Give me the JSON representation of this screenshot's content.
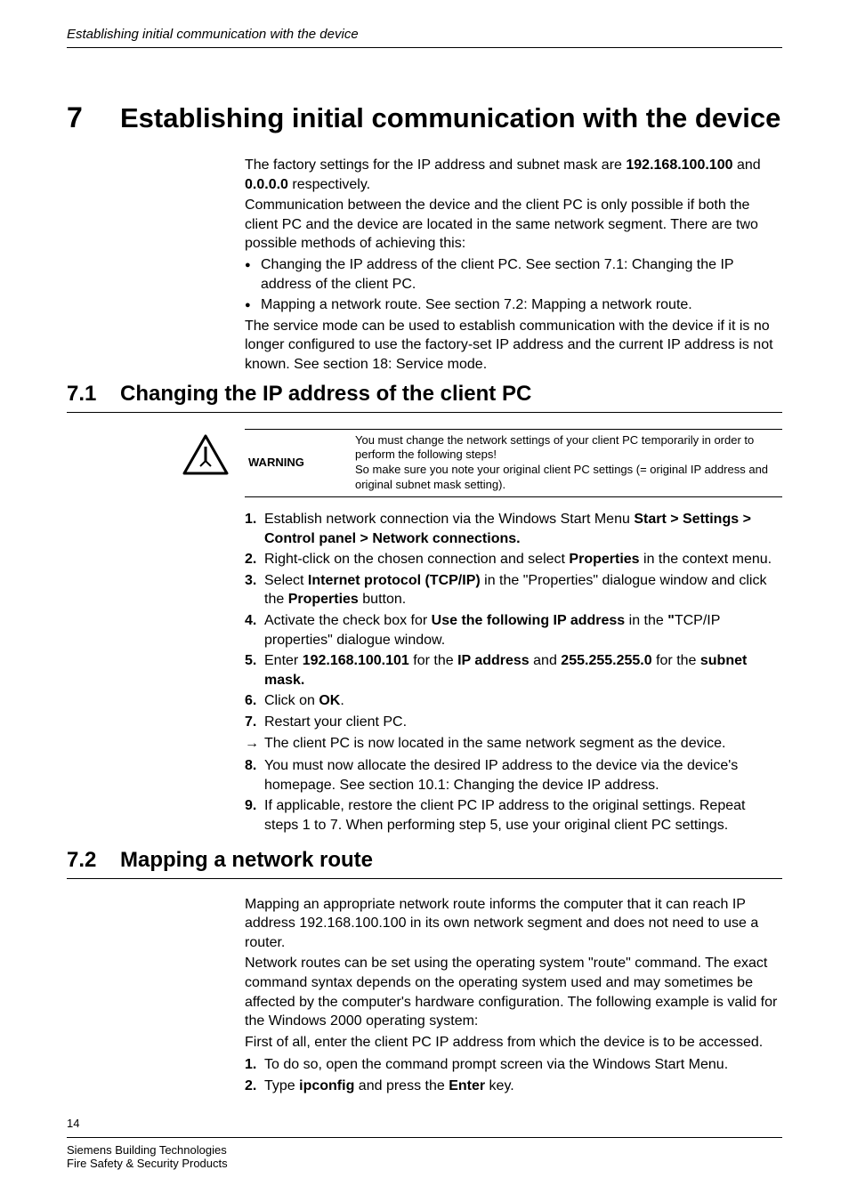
{
  "running_header": "Establishing initial communication with the device",
  "chapter": {
    "num": "7",
    "title": "Establishing initial communication with the device"
  },
  "intro": {
    "p1a": "The factory settings for the IP address and subnet mask are ",
    "p1_ip": "192.168.100.100",
    "p1b": " and ",
    "p1_mask": "0.0.0.0",
    "p1c": " respectively.",
    "p2": "Communication between the device and the client PC is only possible if both the client PC and the device are located in the same network segment. There are two possible methods of achieving this:",
    "bullet1": "Changing the IP address of the client PC. See section 7.1: Changing the IP address of the client PC.",
    "bullet2": "Mapping a network route. See section 7.2: Mapping a network route.",
    "p3": "The service mode can be used to establish communication with the device if it is no longer configured to use the factory-set IP address and the current IP address is not known. See section 18: Service mode."
  },
  "s71": {
    "num": "7.1",
    "title": "Changing the IP address of the client PC",
    "warning_label": "WARNING",
    "warning_text1": "You must change the network settings of your client PC temporarily in order to perform the following steps!",
    "warning_text2": "So make sure you note your original client PC settings (= original IP address and original subnet mask setting).",
    "step1a": "Establish network connection via the Windows Start Menu ",
    "step1b": "Start > Settings > Control panel > Network connections.",
    "step2a": "Right-click on the chosen connection and select ",
    "step2b": "Properties",
    "step2c": " in the context menu.",
    "step3a": "Select ",
    "step3b": "Internet protocol (TCP/IP)",
    "step3c": " in the \"Properties\" dialogue window and click the ",
    "step3d": "Properties",
    "step3e": " button.",
    "step4a": "Activate the check box for ",
    "step4b": "Use the following IP address",
    "step4c": " in the ",
    "step4d": "\"",
    "step4e": "TCP/IP properties\" dialogue window.",
    "step5a": "Enter ",
    "step5b": "192.168.100.101",
    "step5c": " for the ",
    "step5d": "IP address",
    "step5e": " and ",
    "step5f": "255.255.255.0",
    "step5g": " for the ",
    "step5h": "subnet mask.",
    "step6a": "Click on ",
    "step6b": "OK",
    "step6c": ".",
    "step7": "Restart your client PC.",
    "result": "The client PC is now located in the same network segment as the device.",
    "step8": "You must now allocate the desired IP address to the device via the device's homepage. See section 10.1: Changing the device IP address.",
    "step9": "If applicable, restore the client PC IP address to the original settings. Repeat steps 1 to 7. When performing step 5, use your original client PC settings."
  },
  "s72": {
    "num": "7.2",
    "title": "Mapping a network route",
    "p1": "Mapping an appropriate network route informs the computer that it can reach IP address 192.168.100.100 in its own network segment and does not need to use a router.",
    "p2": "Network routes can be set using the operating system \"route\" command. The exact command syntax depends on the operating system used and may sometimes be affected by the computer's hardware configuration. The following example is valid for the Windows 2000 operating system:",
    "p3": "First of all, enter the client PC IP address from which the device is to be accessed.",
    "step1": "To do so, open the command prompt screen via the Windows Start Menu.",
    "step2a": "Type ",
    "step2b": "ipconfig",
    "step2c": " and press the ",
    "step2d": "Enter",
    "step2e": " key."
  },
  "footer": {
    "page": "14",
    "line1": "Siemens Building Technologies",
    "line2": "Fire Safety & Security Products"
  }
}
